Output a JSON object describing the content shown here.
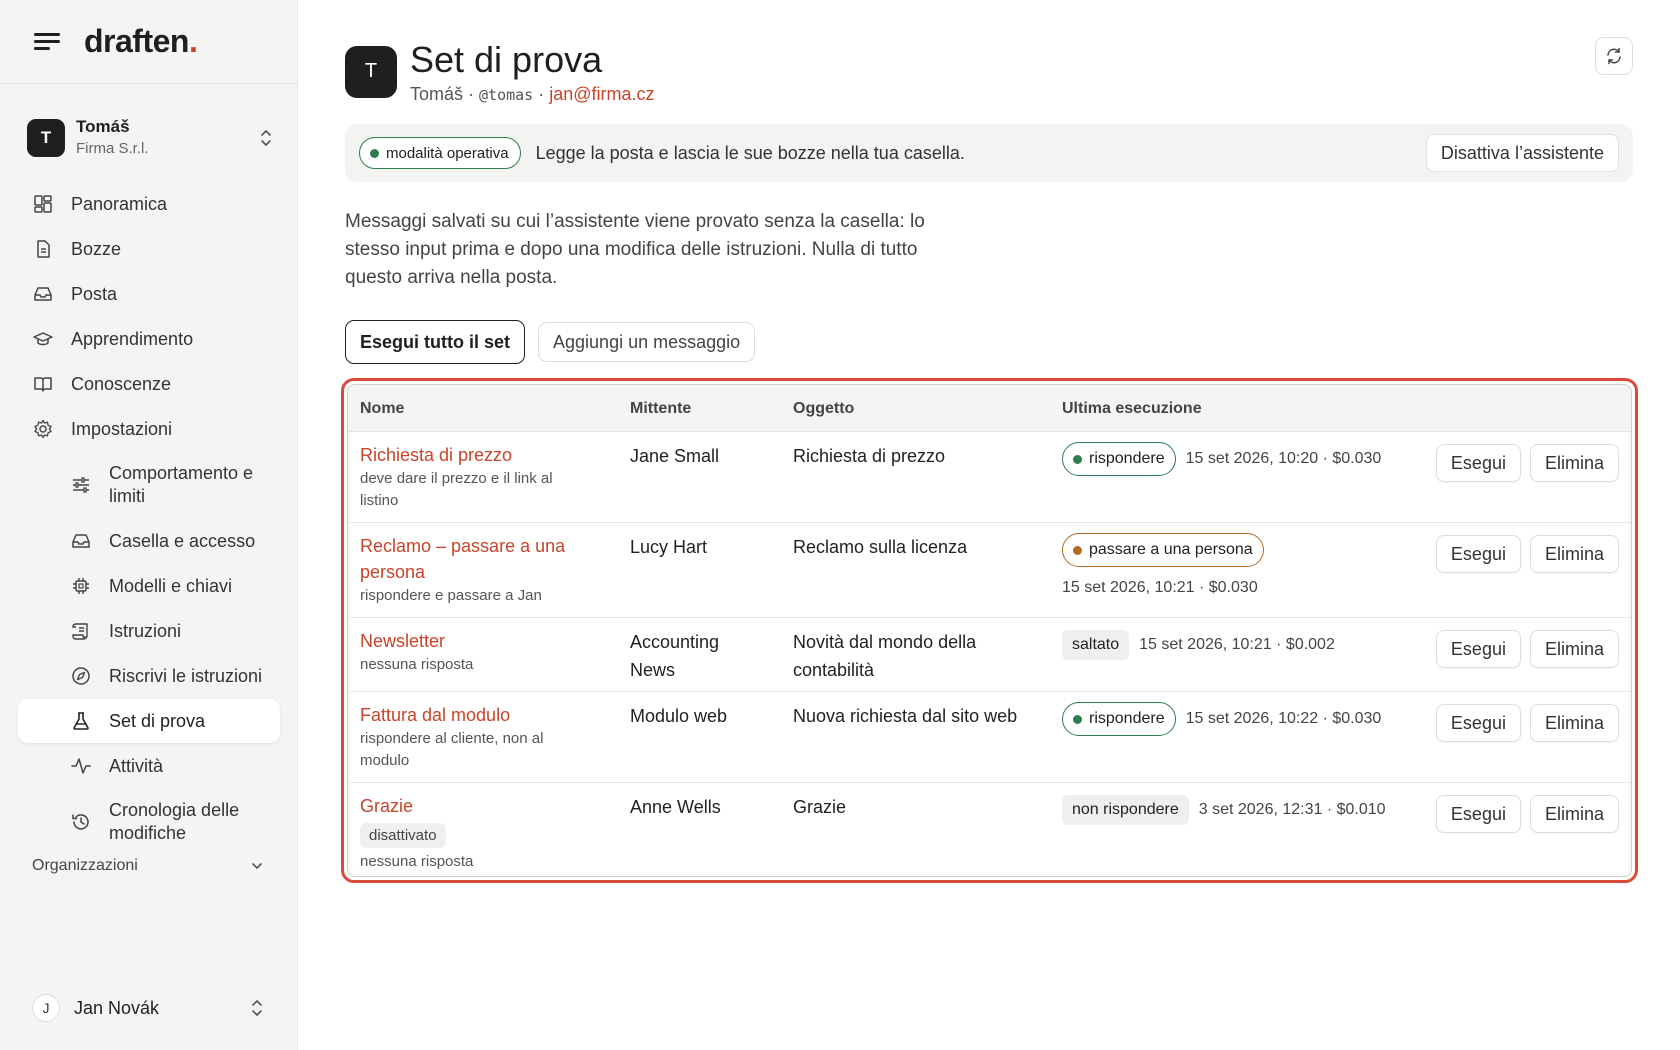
{
  "app": {
    "logo": "draften",
    "logo_dot": "."
  },
  "account": {
    "initial": "T",
    "name": "Tomáš",
    "org": "Firma S.r.l."
  },
  "nav": {
    "panoramica": "Panoramica",
    "bozze": "Bozze",
    "posta": "Posta",
    "apprendimento": "Apprendimento",
    "conoscenze": "Conoscenze",
    "impostazioni": "Impostazioni",
    "comportamento": "Comportamento e limiti",
    "casella": "Casella e accesso",
    "modelli": "Modelli e chiavi",
    "istruzioni": "Istruzioni",
    "riscrivi": "Riscrivi le istruzioni",
    "set": "Set di prova",
    "attivita": "Attività",
    "cronologia": "Cronologia delle modifiche"
  },
  "organizations_label": "Organizzazioni",
  "user": {
    "initial": "J",
    "name": "Jan Novák"
  },
  "header": {
    "avatar": "T",
    "title": "Set di prova",
    "name": "Tomáš",
    "sep1": " · ",
    "handle": "@tomas",
    "sep2": " · ",
    "email": "jan@firma.cz"
  },
  "banner": {
    "mode": "modalità operativa",
    "text": "Legge la posta e lascia le sue bozze nella tua casella.",
    "deactivate": "Disattiva l’assistente"
  },
  "description": "Messaggi salvati su cui l’assistente viene provato senza la casella: lo stesso input prima e dopo una modifica delle istruzioni. Nulla di tutto questo arriva nella posta.",
  "actions": {
    "run_all": "Esegui tutto il set",
    "add": "Aggiungi un messaggio"
  },
  "table": {
    "headers": {
      "name": "Nome",
      "sender": "Mittente",
      "subject": "Oggetto",
      "last_run": "Ultima esecuzione"
    },
    "run_label": "Esegui",
    "delete_label": "Elimina",
    "rows": [
      {
        "name": "Richiesta di prezzo",
        "note": "deve dare il prezzo e il link al listino",
        "sender": "Jane Small",
        "subject": "Richiesta di prezzo",
        "status": "rispondere",
        "meta": "15 set 2026, 10:20 · $0.030"
      },
      {
        "name": "Reclamo – passare a una persona",
        "note": "rispondere e passare a Jan",
        "sender": "Lucy Hart",
        "subject": "Reclamo sulla licenza",
        "status": "passare a una persona",
        "meta": "15 set 2026, 10:21 · $0.030"
      },
      {
        "name": "Newsletter",
        "note": "nessuna risposta",
        "sender": "Accounting News",
        "subject": "Novità dal mondo della contabilità",
        "status": "saltato",
        "meta": "15 set 2026, 10:21 · $0.002"
      },
      {
        "name": "Fattura dal modulo",
        "note": "rispondere al cliente, non al modulo",
        "sender": "Modulo web",
        "subject": "Nuova richiesta dal sito web",
        "status": "rispondere",
        "meta": "15 set 2026, 10:22 · $0.030"
      },
      {
        "name": "Grazie",
        "tag": "disattivato",
        "note": "nessuna risposta",
        "sender": "Anne Wells",
        "subject": "Grazie",
        "status": "non rispondere",
        "meta": "3 set 2026, 12:31 · $0.010"
      }
    ]
  },
  "colors": {
    "accent": "#c8442a",
    "green": "#2e7d4f",
    "orange": "#b56a1d",
    "highlight": "#d84a3a"
  }
}
